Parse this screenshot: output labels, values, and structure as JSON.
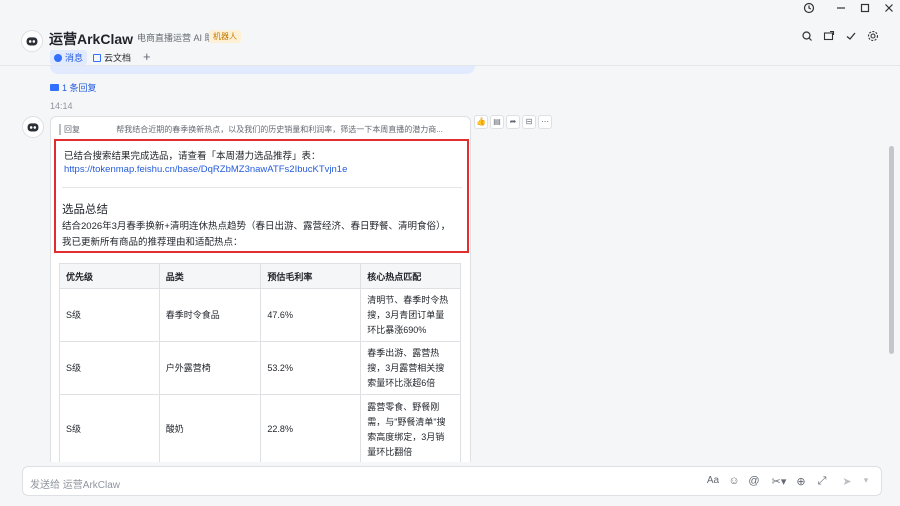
{
  "window": {
    "history_icon": "history-icon",
    "min_icon": "minimize-icon",
    "max_icon": "maximize-icon",
    "close_icon": "close-icon"
  },
  "header": {
    "title": "运营ArkClaw",
    "subtitle": "电商直播运营 AI 助手",
    "badge": "机器人",
    "tabs": [
      {
        "label": "消息",
        "active": true
      },
      {
        "label": "云文档",
        "active": false
      }
    ],
    "add_tab": "+"
  },
  "chat": {
    "reply_count": "1 条回复",
    "time": "14:14",
    "quote_label": "回复",
    "quote_text": "帮我结合近期的春季换新热点，以及我们的历史销量和利润率，筛选一下本周直播的潜力商...",
    "line1": "已结合搜索结果完成选品，请查看「本周潜力选品推荐」表：",
    "link": "https://tokenmap.feishu.cn/base/DqRZbMZ3nawATFs2IbucKTvjn1e",
    "summary_title": "选品总结",
    "summary_line1": "结合2026年3月春季换新+清明连休热点趋势（春日出游、露营经济、春日野餐、清明食俗），",
    "summary_line2": "我已更新所有商品的推荐理由和适配热点：",
    "table": {
      "headers": [
        "优先级",
        "品类",
        "预估毛利率",
        "核心热点匹配"
      ],
      "rows": [
        [
          "S级",
          "春季时令食品",
          "47.6%",
          [
            "清明节、春季时令热",
            "搜，3月青团订单量",
            "环比暴涨690%"
          ]
        ],
        [
          "S级",
          "户外露营椅",
          "53.2%",
          [
            "春季出游、露营热",
            "搜，3月露营相关搜",
            "索量环比涨超6倍"
          ]
        ],
        [
          "S级",
          "酸奶",
          "22.8%",
          [
            "露营零食、野餐刚",
            "需，与\"野餐清单\"搜",
            "索高度绑定，3月销",
            "量环比翻倍"
          ]
        ]
      ]
    }
  },
  "input": {
    "placeholder": "发送给 运营ArkClaw"
  },
  "colors": {
    "accent": "#3370ff",
    "highlight": "#e02d2d",
    "link": "#245bdb"
  }
}
